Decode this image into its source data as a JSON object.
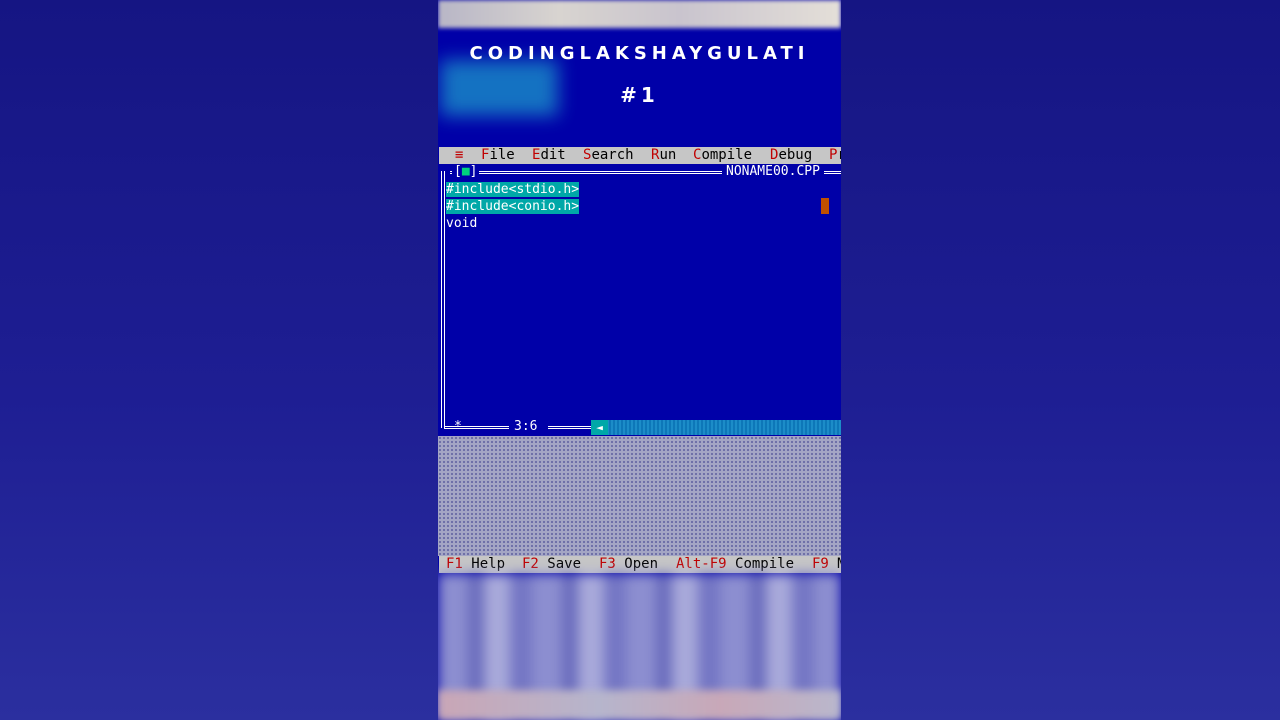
{
  "overlay": {
    "channel": "CODINGLAKSHAYGULATI",
    "episode": "#1"
  },
  "menu": {
    "system_icon": "≡",
    "items": [
      {
        "hot": "F",
        "rest": "ile"
      },
      {
        "hot": "E",
        "rest": "dit"
      },
      {
        "hot": "S",
        "rest": "earch"
      },
      {
        "hot": "R",
        "rest": "un"
      },
      {
        "hot": "C",
        "rest": "ompile"
      },
      {
        "hot": "D",
        "rest": "ebug"
      },
      {
        "hot": "P",
        "rest": "r"
      }
    ]
  },
  "editor": {
    "close_box_left": "[",
    "close_box_mark": "■",
    "close_box_right": "]",
    "filename": "NONAME00.CPP",
    "lines": [
      "#include<stdio.h>",
      "#include<conio.h>",
      "void"
    ],
    "cursor_position": "3:6",
    "modified_marker": "*",
    "scroll_arrow": "◄"
  },
  "status": {
    "items": [
      {
        "key": "F1",
        "label": "Help"
      },
      {
        "key": "F2",
        "label": "Save"
      },
      {
        "key": "F3",
        "label": "Open"
      },
      {
        "key": "Alt-F9",
        "label": "Compile"
      },
      {
        "key": "F9",
        "label": "M"
      }
    ]
  },
  "colors": {
    "editor_bg": "#0000a8",
    "menu_bg": "#c6c6c6",
    "hotkey": "#c00000",
    "selection": "#00a8a8",
    "cursor": "#c05000"
  }
}
